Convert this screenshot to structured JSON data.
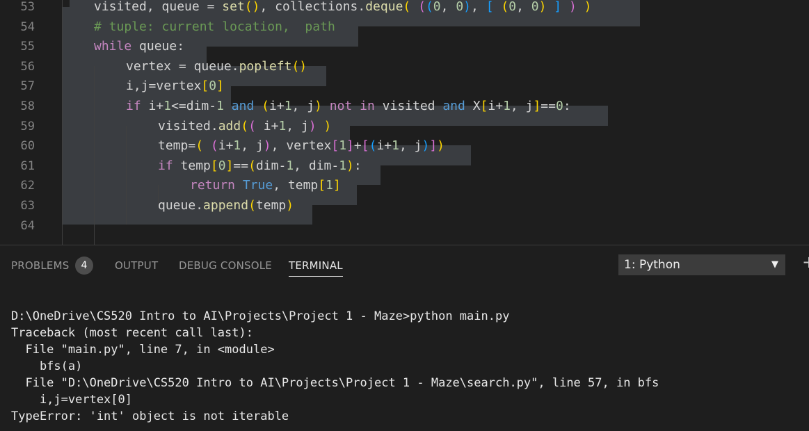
{
  "editor": {
    "line_numbers": [
      "53",
      "54",
      "55",
      "56",
      "57",
      "58",
      "59",
      "60",
      "61",
      "62",
      "63",
      "64"
    ],
    "code": [
      "visited, queue = set(), collections.deque( ((0, 0), [ (0, 0) ] ) )",
      "# tuple: current location,  path",
      "while queue:",
      "vertex = queue.popleft()",
      "i,j=vertex[0]",
      "if i+1<=dim-1 and (i+1, j) not in visited and X[i+1, j]==0:",
      "visited.add(( i+1, j) )",
      "temp=( (i+1, j), vertex[1]+[(i+1, j)])",
      "if temp[0]==(dim-1, dim-1):",
      "return True, temp[1]",
      "queue.append(temp)",
      ""
    ]
  },
  "panel": {
    "tabs": [
      {
        "label": "PROBLEMS",
        "badge": "4"
      },
      {
        "label": "OUTPUT"
      },
      {
        "label": "DEBUG CONSOLE"
      },
      {
        "label": "TERMINAL"
      }
    ],
    "terminal_select": "1: Python",
    "plus": "+"
  },
  "terminal": {
    "lines": [
      "D:\\OneDrive\\CS520 Intro to AI\\Projects\\Project 1 - Maze>python main.py",
      "Traceback (most recent call last):",
      "  File \"main.py\", line 7, in <module>",
      "    bfs(a)",
      "  File \"D:\\OneDrive\\CS520 Intro to AI\\Projects\\Project 1 - Maze\\search.py\", line 57, in bfs",
      "    i,j=vertex[0]",
      "TypeError: 'int' object is not iterable"
    ]
  },
  "colors": {
    "background": "#1e1e1e",
    "selection": "#3a3d41",
    "keyword": "#c586c0",
    "keyword2": "#569cd6",
    "function": "#dcdcaa",
    "comment": "#6a9955",
    "number": "#b5cea8"
  }
}
